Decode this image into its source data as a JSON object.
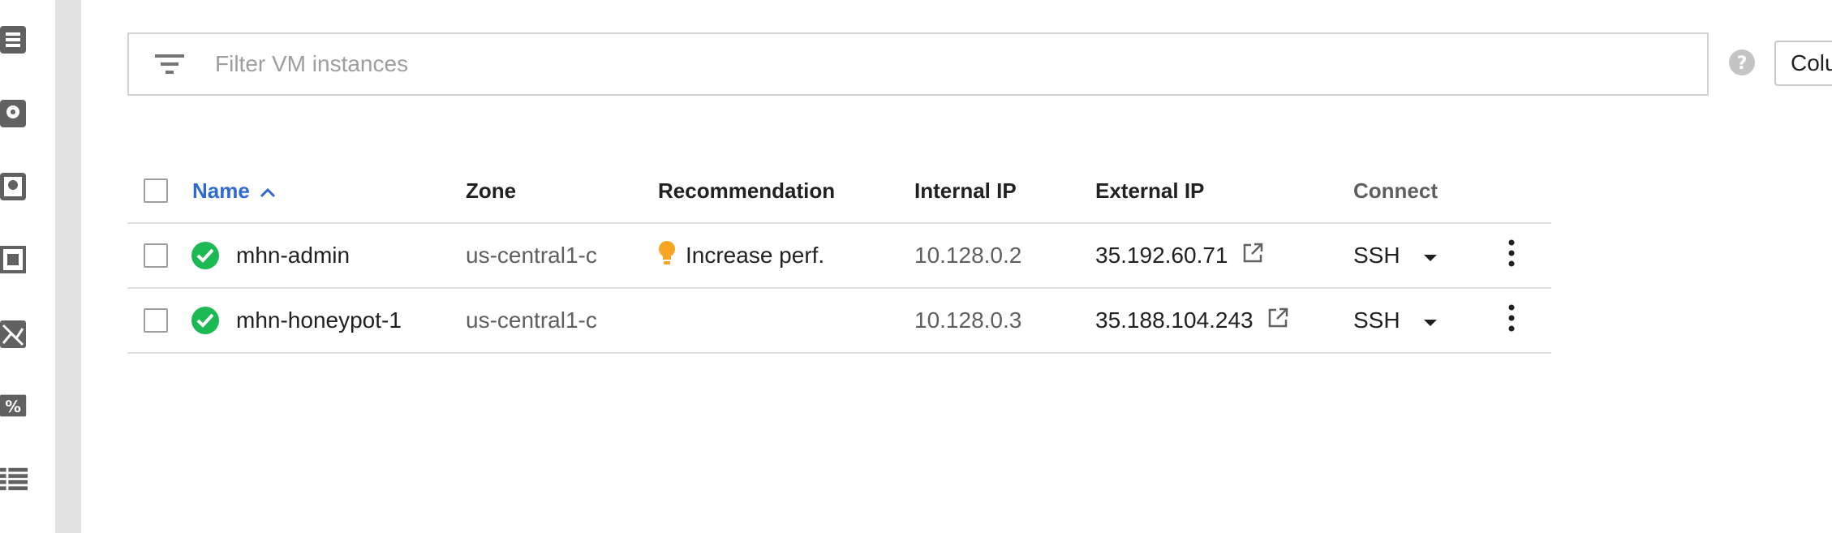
{
  "filter": {
    "placeholder": "Filter VM instances"
  },
  "toolbar": {
    "columns_label": "Colu"
  },
  "table": {
    "headers": {
      "name": "Name",
      "zone": "Zone",
      "recommendation": "Recommendation",
      "internal_ip": "Internal IP",
      "external_ip": "External IP",
      "connect": "Connect"
    },
    "rows": [
      {
        "name": "mhn-admin",
        "status": "running",
        "zone": "us-central1-c",
        "recommendation": "Increase perf.",
        "internal_ip": "10.128.0.2",
        "external_ip": "35.192.60.71",
        "connect": "SSH"
      },
      {
        "name": "mhn-honeypot-1",
        "status": "running",
        "zone": "us-central1-c",
        "recommendation": "",
        "internal_ip": "10.128.0.3",
        "external_ip": "35.188.104.243",
        "connect": "SSH"
      }
    ]
  },
  "colors": {
    "accent": "#2f6ad3",
    "status_ok": "#1db954",
    "recommendation": "#f6a623",
    "icon_gray": "#616161"
  },
  "icons": {
    "sidebar": [
      "instance-icon",
      "disk-icon",
      "snapshot-icon",
      "image-icon",
      "instance-template-icon",
      "discount-icon",
      "list-icon"
    ],
    "filter": "filter-icon",
    "help": "help-icon",
    "status": "check-circle-icon",
    "recommendation": "lightbulb-icon",
    "external": "open-in-new-icon",
    "caret": "caret-down-icon",
    "more": "more-vert-icon"
  }
}
